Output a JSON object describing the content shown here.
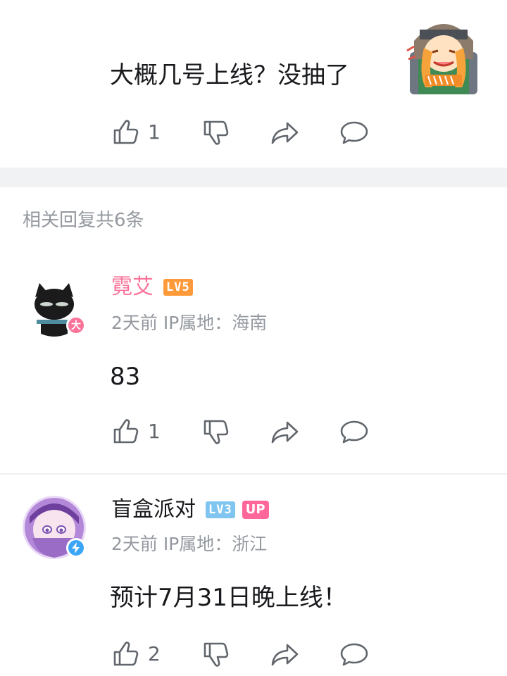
{
  "main_comment": {
    "text": "大概几号上线？没抽了",
    "sticker": "girl-crying-sticker",
    "actions": {
      "like_count": "1"
    }
  },
  "replies_header": "相关回复共6条",
  "replies": [
    {
      "username": "霓艾",
      "username_color": "#fb7299",
      "level_text": "LV5",
      "level_color": "#ff9a3b",
      "badge_icon": "vip-da-badge",
      "meta": "2天前 IP属地：海南",
      "content": "83",
      "like_count": "1"
    },
    {
      "username": "盲盒派对",
      "username_color": "#18191c",
      "level_text": "LV3",
      "level_color": "#7fc5f0",
      "up_label": "UP",
      "badge_icon": "lightning-verified-badge",
      "meta": "2天前 IP属地：浙江",
      "content": "预计7月31日晚上线！",
      "like_count": "2"
    }
  ],
  "icons": {
    "like": "thumb-up-icon",
    "dislike": "thumb-down-icon",
    "share": "share-arrow-icon",
    "reply": "comment-bubble-icon"
  }
}
